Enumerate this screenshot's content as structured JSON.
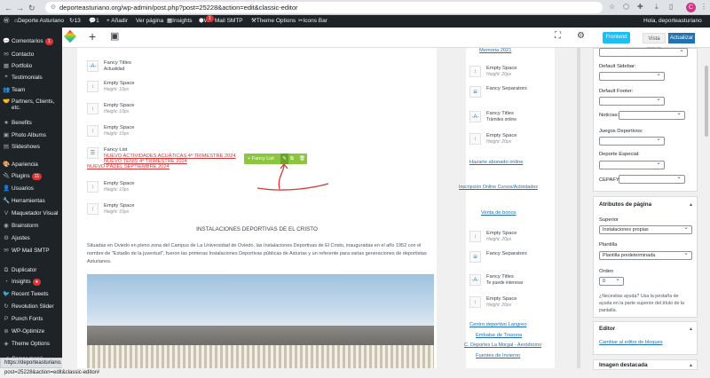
{
  "browser": {
    "url": "deporteasturiano.org/wp-admin/post.php?post=25228&action=edit&classic-editor",
    "profile_initial": "C"
  },
  "adminbar": {
    "site": "Deporte Asturiano",
    "updates": "13",
    "comments": "1",
    "add_new": "+ Añadir",
    "view_page": "Ver página",
    "insights": "Insights",
    "smtp": "WP Mail SMTP",
    "smtp_badge": "1",
    "theme_options": "Theme Options",
    "icons_bar": "Icons Bar",
    "greeting": "Hola, deporteasturiano"
  },
  "sidebar": {
    "items": [
      {
        "icon": "💬",
        "label": "Comentarios",
        "badge": "1"
      },
      {
        "icon": "✉",
        "label": "Contacto"
      },
      {
        "icon": "▦",
        "label": "Portfolio"
      },
      {
        "icon": "❝",
        "label": "Testimonials"
      },
      {
        "icon": "👥",
        "label": "Team"
      },
      {
        "icon": "🤝",
        "label": "Partners, Clients, etc."
      },
      {
        "icon": "★",
        "label": "Benefits"
      },
      {
        "icon": "▣",
        "label": "Photo Albums"
      },
      {
        "icon": "▤",
        "label": "Slideshows"
      },
      {
        "icon": "🎨",
        "label": "Apariencia"
      },
      {
        "icon": "🔌",
        "label": "Plugins",
        "badge": "11"
      },
      {
        "icon": "👤",
        "label": "Usuarios"
      },
      {
        "icon": "🔧",
        "label": "Herramientas"
      },
      {
        "icon": "V",
        "label": "Maquetador Visual"
      },
      {
        "icon": "◉",
        "label": "Brainstorm"
      },
      {
        "icon": "⚙",
        "label": "Ajustes"
      },
      {
        "icon": "✉",
        "label": "WP Mail SMTP"
      },
      {
        "icon": "⧉",
        "label": "Duplicator"
      },
      {
        "icon": "◔",
        "label": "Insights",
        "badge": "●"
      },
      {
        "icon": "🐦",
        "label": "Recent Tweets"
      },
      {
        "icon": "↻",
        "label": "Revolution Slider"
      },
      {
        "icon": "P",
        "label": "Punch Fonts"
      },
      {
        "icon": "⊕",
        "label": "WP-Optimize"
      },
      {
        "icon": "◈",
        "label": "Theme Options"
      },
      {
        "icon": "◀",
        "label": "Cerrar menú"
      }
    ]
  },
  "status_url": "https://deporteasturiano.org/wp-admin/post.php?post=25228&action=edit&classic-editor#",
  "toolbar": {
    "frontend": "Frontend",
    "preview": "Vista previa",
    "update": "Actualizar"
  },
  "left_column": {
    "fancy1": {
      "title": "Fancy Titles",
      "sub": "Actualidad"
    },
    "empty1": {
      "title": "Empty Space",
      "sub": "Height: 10px"
    },
    "empty2": {
      "title": "Empty Space",
      "sub": "Height: 10px"
    },
    "empty3": {
      "title": "Empty Space",
      "sub": "Height: 10px"
    },
    "fancy_list": {
      "title": "Fancy List",
      "links": [
        "NUEVO  ACTIVIDADES ACUÁTICAS 4º TRIMESTRE 2024",
        "NUEVO  TENIS 4º TRIMESTRE 2024",
        "NUEVO PÁDEL SEPTIEMBRE 2024"
      ]
    },
    "controls_label": "+ Fancy List",
    "empty4": {
      "title": "Empty Space",
      "sub": "Height: 10px"
    },
    "empty5": {
      "title": "Empty Space",
      "sub": "Height: 10px"
    },
    "heading": "INSTALACIONES DEPORTIVAS DE EL CRISTO",
    "paragraph": "Situadas en Oviedo en pleno zona del Campus de La Universidad de Oviedo, las Instalaciones Deportivas de El Cristo, inauguradas en el año 1952 con el nombre de \"Estadio de la juventud\", fueron las primeras Instalaciones Deportivas públicas de Asturias y un referente para varias generaciones de deportistas Asturianos."
  },
  "right_column": {
    "memoria": "Memoria 2021",
    "empty1": {
      "title": "Empty Space",
      "sub": "Height: 20px"
    },
    "sep1": {
      "title": "Fancy Separators"
    },
    "fancy1": {
      "title": "Fancy Titles",
      "sub": "Trámites online"
    },
    "empty2": {
      "title": "Empty Space",
      "sub": "Height: 20px"
    },
    "abonado": "Hazarte abonado online",
    "inscripcion": "Inscripción Online Cursos/Actividades",
    "bonos": "Venta de bonos",
    "empty3": {
      "title": "Empty Space",
      "sub": "Height: 20px"
    },
    "sep2": {
      "title": "Fancy Separators"
    },
    "fancy2": {
      "title": "Fancy Titles",
      "sub": "Te puede interesar"
    },
    "empty4": {
      "title": "Empty Space",
      "sub": "Height: 20px"
    },
    "links": [
      "Centro deportivo Langreo",
      "Embalse de Trasona",
      "C. Deportes La Morgal - Aeródromo",
      "Fuentes de Invierno"
    ]
  },
  "meta": {
    "default_sidebar": "Default Sidebar:",
    "default_footer": "Default Footer:",
    "noticias": "Noticias:",
    "juegos": "Juegos Deportivos:",
    "deporte_especial": "Deporte Especial:",
    "cepafys": "CEPAFYS:",
    "attributes_title": "Atributos de página",
    "superior_label": "Superior",
    "superior_value": "Instalaciones propias",
    "plantilla_label": "Plantilla",
    "plantilla_value": "Plantilla predeterminada",
    "orden_label": "Orden",
    "orden_value": "0",
    "help": "¿Necesitas ayuda? Usa la pestaña de ayuda en la parte superior del título de la pantalla.",
    "editor_title": "Editor",
    "editor_link": "Cambiar al editor de bloques",
    "imagen_title": "Imagen destacada"
  }
}
